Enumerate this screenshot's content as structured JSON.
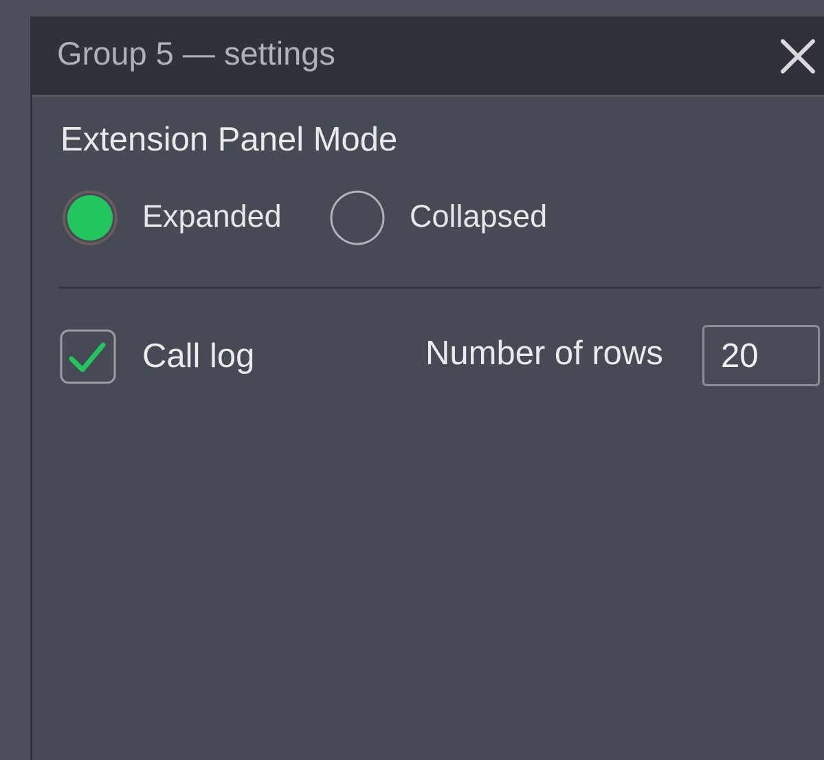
{
  "dialog": {
    "title": "Group 5 — settings",
    "close_icon": "close-icon"
  },
  "extension_panel": {
    "heading": "Extension Panel Mode",
    "options": [
      {
        "label": "Expanded",
        "selected": true
      },
      {
        "label": "Collapsed",
        "selected": false
      }
    ]
  },
  "call_log": {
    "label": "Call log",
    "checked": true,
    "check_icon": "checkmark-icon"
  },
  "rows": {
    "label": "Number of rows",
    "value": "20"
  },
  "colors": {
    "accent_green": "#22c55e",
    "radio_border": "#b0b3b9",
    "titlebar": "#2f323a",
    "panel": "#464a55"
  }
}
